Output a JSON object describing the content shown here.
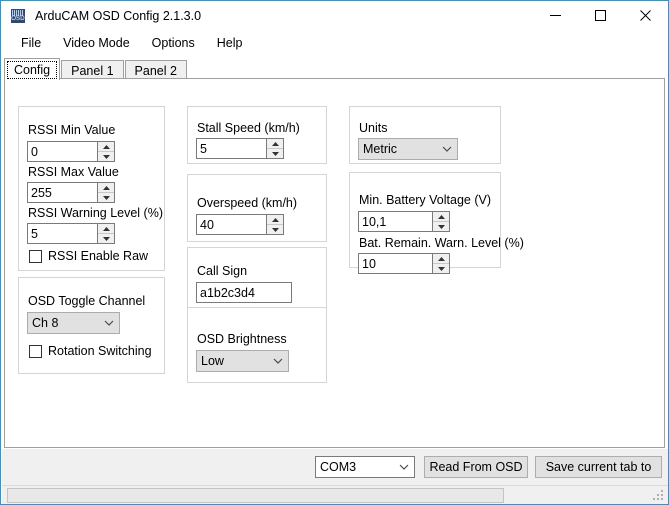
{
  "window": {
    "title": "ArduCAM OSD Config 2.1.3.0",
    "icon_label": "OSD",
    "minimize_label": "Minimize",
    "maximize_label": "Maximize",
    "close_label": "Close",
    "accent_color": "#0aa3e8"
  },
  "menu": {
    "items": [
      {
        "label": "File"
      },
      {
        "label": "Video Mode"
      },
      {
        "label": "Options"
      },
      {
        "label": "Help"
      }
    ]
  },
  "tabs": {
    "selected_index": 0,
    "items": [
      {
        "label": "Config"
      },
      {
        "label": "Panel 1"
      },
      {
        "label": "Panel 2"
      }
    ]
  },
  "config": {
    "rssi_group": {
      "min_label": "RSSI Min Value",
      "min_value": "0",
      "max_label": "RSSI Max Value",
      "max_value": "255",
      "warning_label": "RSSI Warning Level (%)",
      "warning_value": "5",
      "enable_raw_label": "RSSI Enable Raw",
      "enable_raw_checked": false
    },
    "toggle_group": {
      "channel_label": "OSD Toggle Channel",
      "channel_value": "Ch 8",
      "rotation_label": "Rotation Switching",
      "rotation_checked": false
    },
    "stall_group": {
      "label": "Stall Speed (km/h)",
      "value": "5"
    },
    "overspeed_group": {
      "label": "Overspeed (km/h)",
      "value": "40"
    },
    "callsign_group": {
      "label": "Call Sign",
      "value": "a1b2c3d4"
    },
    "brightness_group": {
      "label": "OSD Brightness",
      "value": "Low"
    },
    "units_group": {
      "label": "Units",
      "value": "Metric"
    },
    "battery_group": {
      "min_voltage_label": "Min. Battery Voltage (V)",
      "min_voltage_value": "10,1",
      "remain_warn_label": "Bat. Remain. Warn. Level (%)",
      "remain_warn_value": "10"
    }
  },
  "bottom": {
    "port_value": "COM3",
    "read_label": "Read From OSD",
    "save_label": "Save current tab to"
  },
  "status": {
    "message": ""
  }
}
